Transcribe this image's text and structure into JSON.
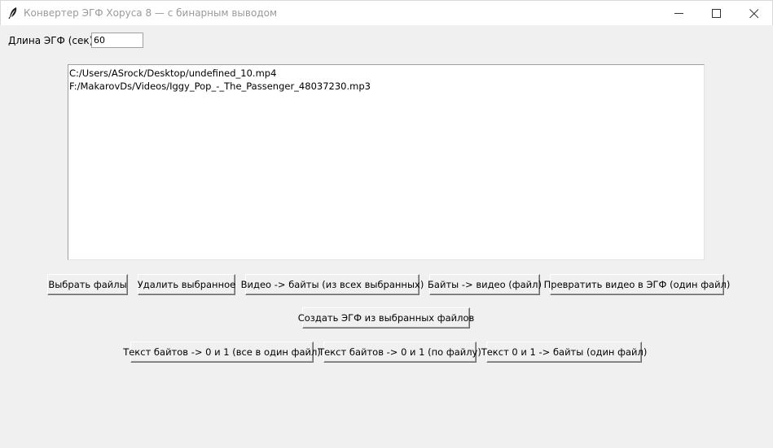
{
  "window": {
    "title": "Конвертер ЭГФ Хоруса 8 — с бинарным выводом",
    "icon": "feather-icon"
  },
  "egf_length": {
    "label": "Длина ЭГФ (сек):",
    "value": "60"
  },
  "files": [
    "C:/Users/ASrock/Desktop/undefined_10.mp4",
    "F:/MakarovDs/Videos/Iggy_Pop_-_The_Passenger_48037230.mp3"
  ],
  "buttons_row1": {
    "select_files": "Выбрать файлы",
    "delete_selected": "Удалить выбранное",
    "video_to_bytes": "Видео -> байты (из всех выбранных)",
    "bytes_to_video": "Байты -> видео (файл)",
    "video_to_egf": "Превратить видео в ЭГФ (один файл)"
  },
  "buttons_row2": {
    "create_egf": "Создать ЭГФ из выбранных файлов"
  },
  "buttons_row3": {
    "bytes_text_to_binary_all": "Текст байтов -> 0 и 1 (все в один файл)",
    "bytes_text_to_binary_each": "Текст байтов -> 0 и 1 (по файлу)",
    "binary_to_bytes": "Текст 0 и 1 -> байты (один файл)"
  }
}
